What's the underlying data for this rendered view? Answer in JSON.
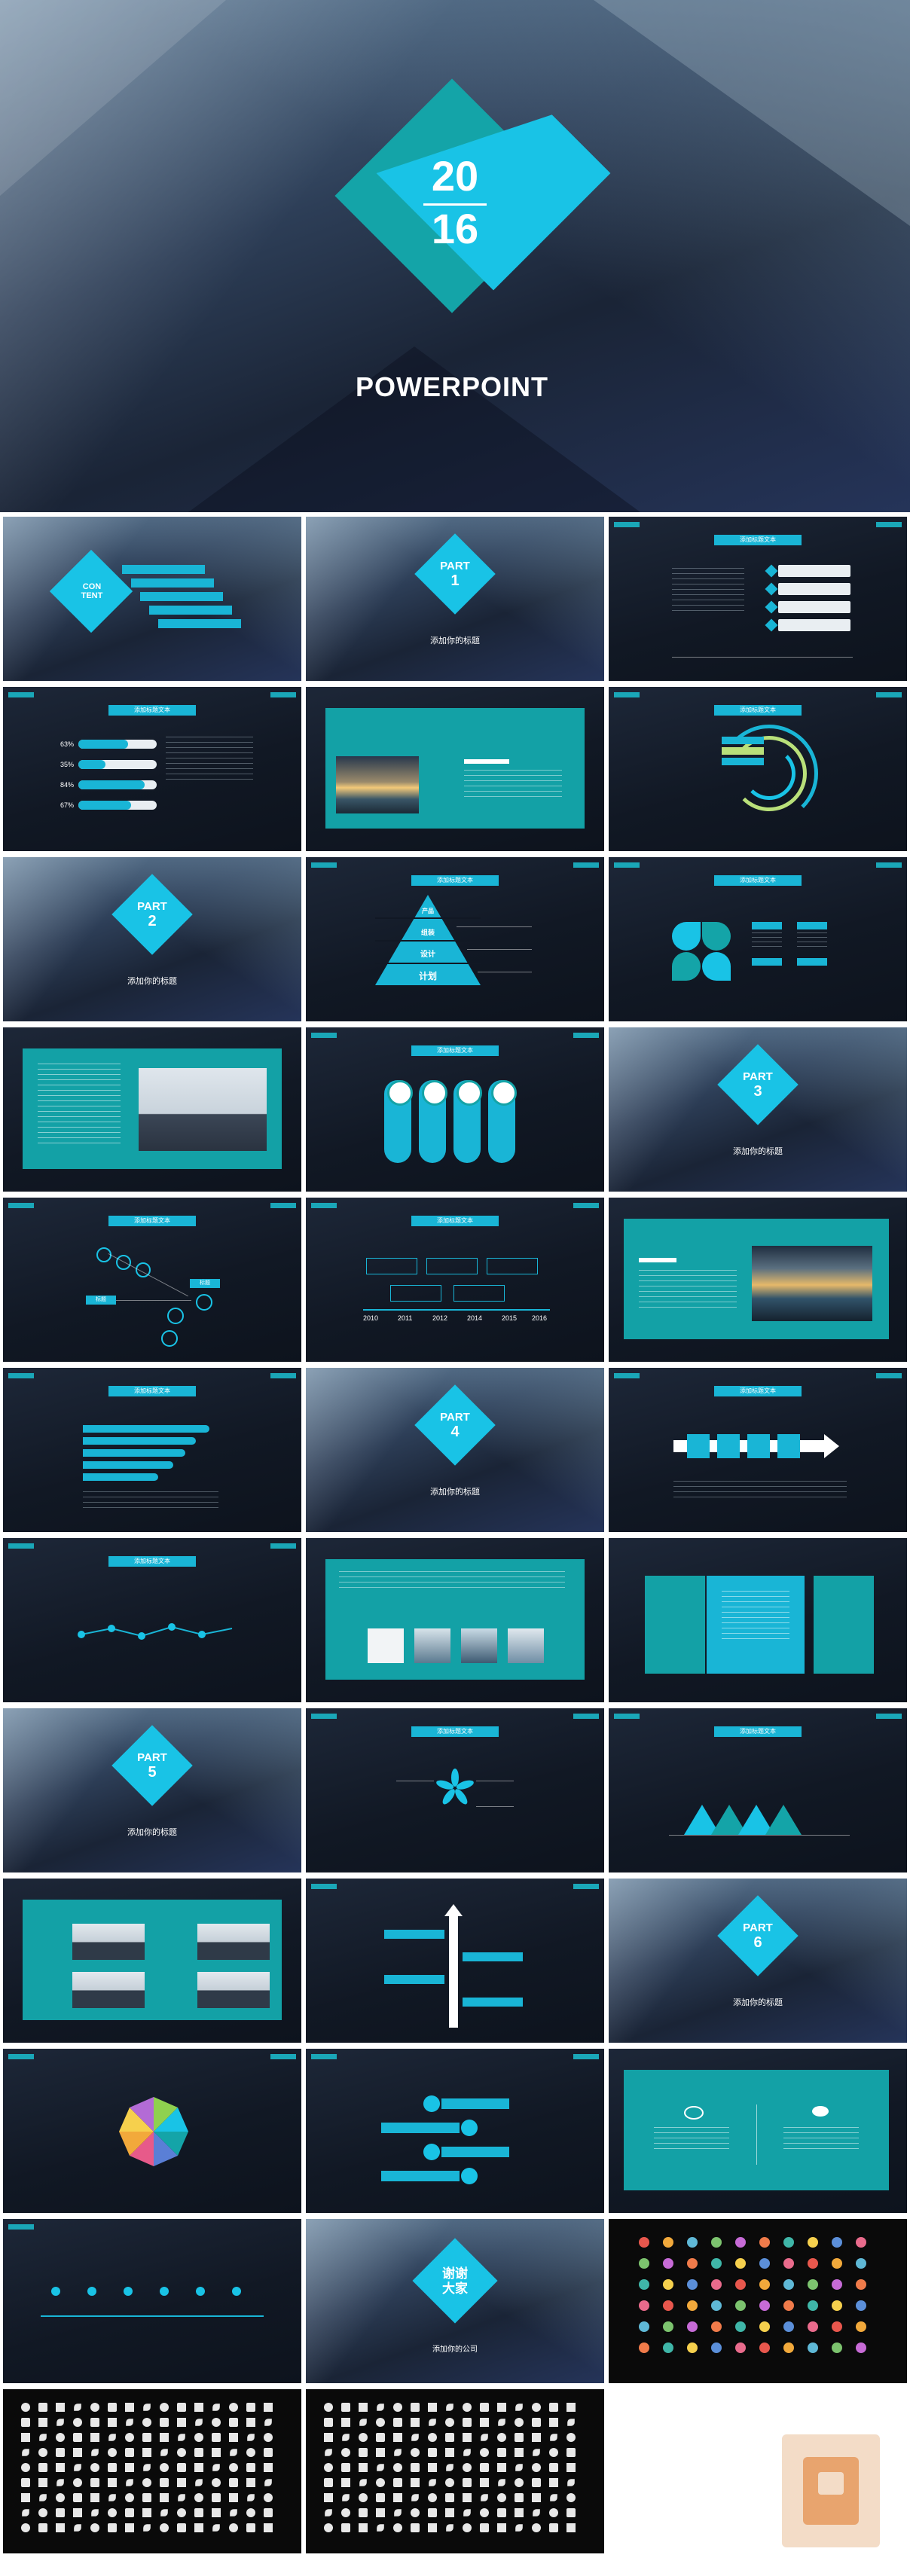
{
  "cover": {
    "year_top": "20",
    "year_bottom": "16",
    "title": "POWERPOINT"
  },
  "content_slide": {
    "label": "CON\nTENT"
  },
  "parts": [
    {
      "word": "PART",
      "num": "1",
      "subtitle": "添加你的标题"
    },
    {
      "word": "PART",
      "num": "2",
      "subtitle": "添加你的标题"
    },
    {
      "word": "PART",
      "num": "3",
      "subtitle": "添加你的标题"
    },
    {
      "word": "PART",
      "num": "4",
      "subtitle": "添加你的标题"
    },
    {
      "word": "PART",
      "num": "5",
      "subtitle": "添加你的标题"
    },
    {
      "word": "PART",
      "num": "6",
      "subtitle": "添加你的标题"
    }
  ],
  "title_label": "添加标题文本",
  "progress_percents": [
    "63%",
    "35%",
    "84%",
    "67%"
  ],
  "pyramid_labels": [
    "计划",
    "设计",
    "组装",
    "产品"
  ],
  "timeline_years": [
    "2010",
    "2011",
    "2012",
    "2014",
    "2015",
    "2016"
  ],
  "flow_labels": [
    "标题",
    "标题",
    "标题",
    "标题"
  ],
  "ending": {
    "line1": "谢谢",
    "line2": "大家",
    "sub": "添加你的公司"
  },
  "icon_colors": [
    "#e8574d",
    "#f2a93b",
    "#5fb8d6",
    "#7cc36e",
    "#c76bd6",
    "#f07b4a",
    "#3fb6a8",
    "#f6d04d",
    "#5b8fd9",
    "#e96b8c"
  ]
}
